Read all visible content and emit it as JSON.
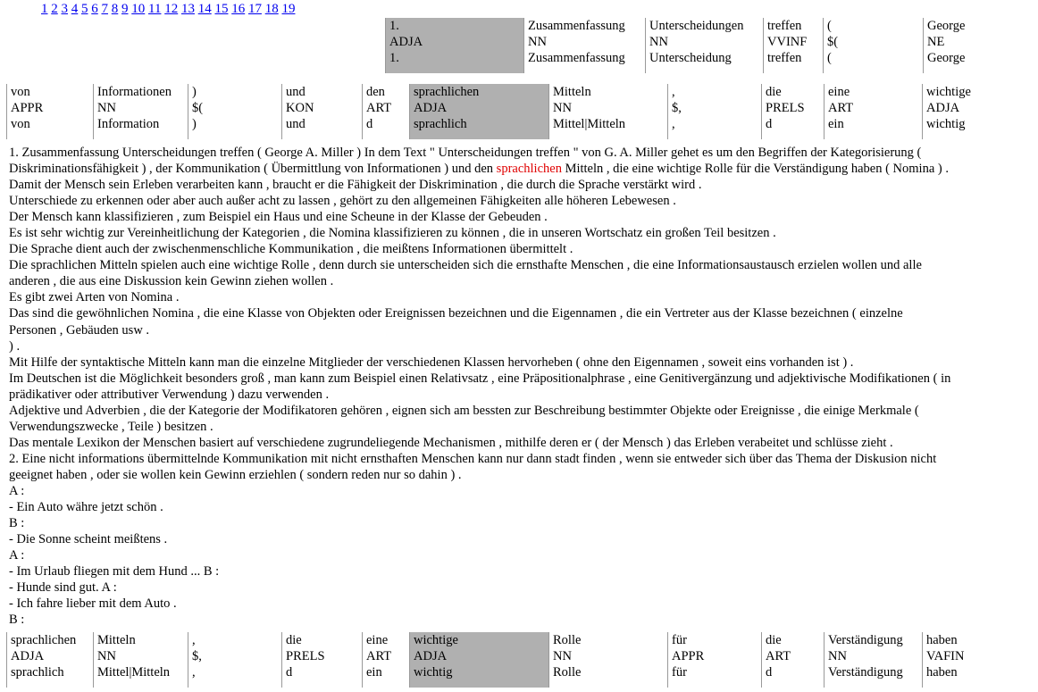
{
  "pagination": [
    "1",
    "2",
    "3",
    "4",
    "5",
    "6",
    "7",
    "8",
    "9",
    "10",
    "11",
    "12",
    "13",
    "14",
    "15",
    "16",
    "17",
    "18",
    "19"
  ],
  "kwic_rows": [
    {
      "id": "t1",
      "highlight_index": 0,
      "cells": [
        {
          "word": "1.",
          "tag": "ADJA",
          "lemma": "1."
        },
        {
          "word": "Zusammenfassung",
          "tag": "NN",
          "lemma": "Zusammenfassung"
        },
        {
          "word": "Unterscheidungen",
          "tag": "NN",
          "lemma": "Unterscheidung"
        },
        {
          "word": "treffen",
          "tag": "VVINF",
          "lemma": "treffen"
        },
        {
          "word": "(",
          "tag": "$(",
          "lemma": "("
        },
        {
          "word": "George",
          "tag": "NE",
          "lemma": "George"
        }
      ]
    },
    {
      "id": "t2",
      "highlight_index": 5,
      "cells": [
        {
          "word": "von",
          "tag": "APPR",
          "lemma": "von"
        },
        {
          "word": "Informationen",
          "tag": "NN",
          "lemma": "Information"
        },
        {
          "word": ")",
          "tag": "$(",
          "lemma": ")"
        },
        {
          "word": "und",
          "tag": "KON",
          "lemma": "und"
        },
        {
          "word": "den",
          "tag": "ART",
          "lemma": "d"
        },
        {
          "word": "sprachlichen",
          "tag": "ADJA",
          "lemma": "sprachlich"
        },
        {
          "word": "Mitteln",
          "tag": "NN",
          "lemma": "Mittel|Mitteln"
        },
        {
          "word": ",",
          "tag": "$,",
          "lemma": ","
        },
        {
          "word": "die",
          "tag": "PRELS",
          "lemma": "d"
        },
        {
          "word": "eine",
          "tag": "ART",
          "lemma": "ein"
        },
        {
          "word": "wichtige",
          "tag": "ADJA",
          "lemma": "wichtig"
        }
      ]
    },
    {
      "id": "t3",
      "highlight_index": 5,
      "cells": [
        {
          "word": "sprachlichen",
          "tag": "ADJA",
          "lemma": "sprachlich"
        },
        {
          "word": "Mitteln",
          "tag": "NN",
          "lemma": "Mittel|Mitteln"
        },
        {
          "word": ",",
          "tag": "$,",
          "lemma": ","
        },
        {
          "word": "die",
          "tag": "PRELS",
          "lemma": "d"
        },
        {
          "word": "eine",
          "tag": "ART",
          "lemma": "ein"
        },
        {
          "word": "wichtige",
          "tag": "ADJA",
          "lemma": "wichtig"
        },
        {
          "word": "Rolle",
          "tag": "NN",
          "lemma": "Rolle"
        },
        {
          "word": "für",
          "tag": "APPR",
          "lemma": "für"
        },
        {
          "word": "die",
          "tag": "ART",
          "lemma": "d"
        },
        {
          "word": "Verständigung",
          "tag": "NN",
          "lemma": "Verständigung"
        },
        {
          "word": "haben",
          "tag": "VAFIN",
          "lemma": "haben"
        }
      ]
    }
  ],
  "text": {
    "keyword": "sprachlichen",
    "line1": "1. Zusammenfassung Unterscheidungen treffen ( George A. Miller ) In dem Text \" Unterscheidungen treffen \" von G. A. Miller gehet es um den Begriffen der Kategorisierung (",
    "line2_before": "Diskriminationsfähigkeit ) , der Kommunikation ( Übermittlung von Informationen ) und den ",
    "line2_after": " Mitteln , die eine wichtige Rolle für die Verständigung haben ( Nomina ) .",
    "lines": [
      "Damit der Mensch sein Erleben verarbeiten kann , braucht er die Fähigkeit der Diskrimination , die durch die Sprache verstärkt wird .",
      "Unterschiede zu erkennen oder aber auch außer acht zu lassen , gehört zu den allgemeinen Fähigkeiten alle höheren Lebewesen .",
      "Der Mensch kann klassifizieren , zum Beispiel ein Haus und eine Scheune in der Klasse der Gebeuden .",
      "Es ist sehr wichtig zur Vereinheitlichung der Kategorien , die Nomina klassifizieren zu können , die in unseren Wortschatz ein großen Teil besitzen .",
      "Die Sprache dient auch der zwischenmenschliche Kommunikation , die meißtens Informationen übermittelt .",
      "Die sprachlichen Mitteln spielen auch eine wichtige Rolle , denn durch sie unterscheiden sich die ernsthafte Menschen , die eine Informationsaustausch erzielen wollen und alle",
      "anderen , die aus eine Diskussion kein Gewinn ziehen wollen .",
      "Es gibt zwei Arten von Nomina .",
      "Das sind die gewöhnlichen Nomina , die eine Klasse von Objekten oder Ereignissen bezeichnen und die Eigennamen , die ein Vertreter aus der Klasse bezeichnen ( einzelne",
      "Personen , Gebäuden usw .",
      ") .",
      "Mit Hilfe der syntaktische Mitteln kann man die einzelne Mitglieder der verschiedenen Klassen hervorheben ( ohne den Eigennamen , soweit eins vorhanden ist ) .",
      "Im Deutschen ist die Möglichkeit besonders groß , man kann zum Beispiel einen Relativsatz , eine Präpositionalphrase , eine Genitivergänzung und adjektivische Modifikationen ( in",
      "prädikativer oder attributiver Verwendung ) dazu verwenden .",
      "Adjektive und Adverbien , die der Kategorie der Modifikatoren gehören , eignen sich am bessten zur Beschreibung bestimmter Objekte oder Ereignisse , die einige Merkmale (",
      "Verwendungszwecke , Teile ) besitzen .",
      "Das mentale Lexikon der Menschen basiert auf verschiedene zugrundeliegende Mechanismen , mithilfe deren er ( der Mensch ) das Erleben verabeitet und schlüsse zieht .",
      "2. Eine nicht informations übermittelnde Kommunikation mit nicht ernsthaften Menschen kann nur dann stadt finden , wenn sie entweder sich über das Thema der Diskusion nicht",
      "geeignet haben , oder sie wollen kein Gewinn erziehlen ( sondern reden nur so dahin ) .",
      "A :",
      "- Ein Auto währe jetzt schön .",
      "B :",
      "- Die Sonne scheint meißtens .",
      "A :",
      "- Im Urlaub fliegen mit dem Hund ... B :",
      "- Hunde sind gut. A :",
      "- Ich fahre lieber mit dem Auto .",
      "B :"
    ]
  }
}
